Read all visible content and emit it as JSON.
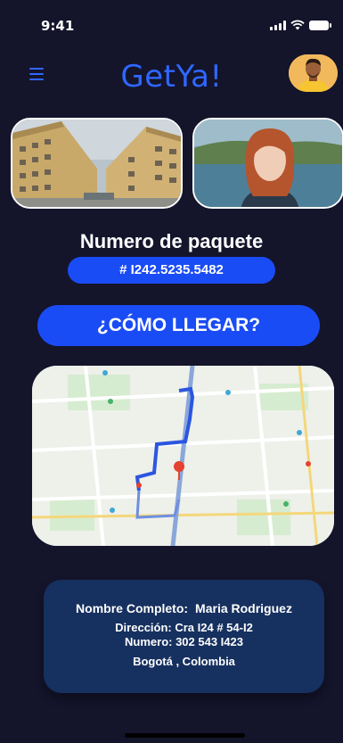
{
  "status": {
    "time": "9:41"
  },
  "app": {
    "title": "GetYa!"
  },
  "package": {
    "title": "Numero de paquete",
    "number": "# I242.5235.5482"
  },
  "cta": {
    "label": "¿CÓMO LLEGAR?"
  },
  "contact": {
    "name_label": "Nombre Completo:",
    "name_value": "Maria Rodriguez",
    "address": "Dirección: Cra I24 # 54-I2",
    "phone": "Numero: 302 543 I423",
    "city": "Bogotá , Colombia"
  },
  "colors": {
    "background": "#14142b",
    "accent": "#1a4cf5",
    "card": "#16305f"
  },
  "icons": {
    "menu": "hamburger-icon",
    "signal": "signal-icon",
    "wifi": "wifi-icon",
    "battery": "battery-icon"
  }
}
